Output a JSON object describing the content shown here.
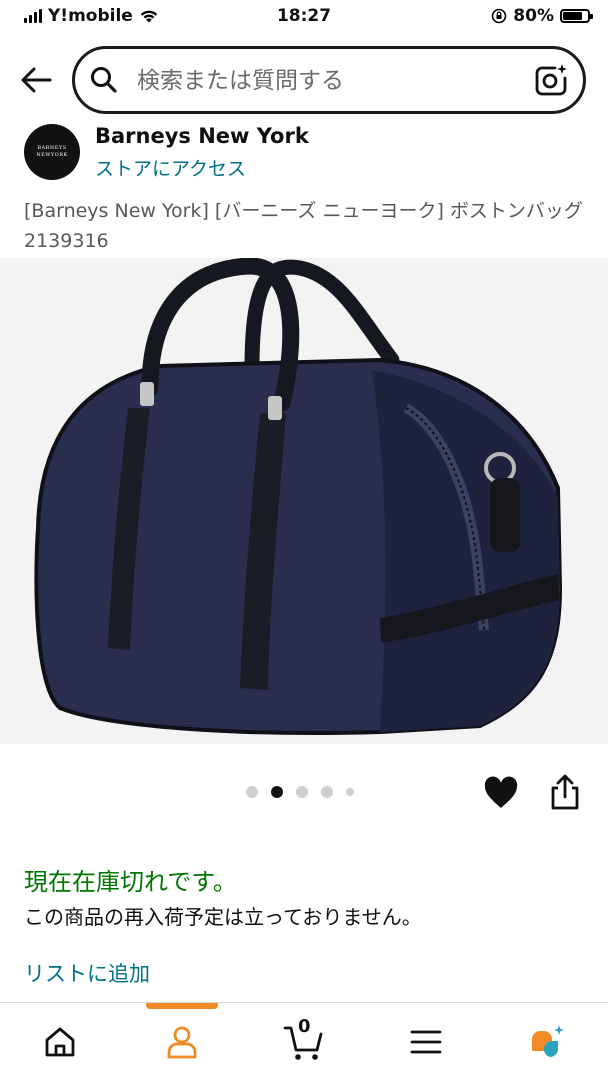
{
  "status_bar": {
    "carrier": "Y!mobile",
    "time": "18:27",
    "battery": "80%",
    "battery_level": 0.8
  },
  "search": {
    "placeholder": "検索または質問する"
  },
  "brand": {
    "name": "Barneys New York",
    "store_link": "ストアにアクセス",
    "logo_line1": "BARNEYS",
    "logo_line2": "NEWYORK"
  },
  "product": {
    "title": "[Barneys New York] [バーニーズ ニューヨーク] ボストンバッグ 2139316"
  },
  "carousel": {
    "total": 5,
    "active_index": 1
  },
  "availability": {
    "status": "現在在庫切れです。",
    "note": "この商品の再入荷予定は立っておりません。"
  },
  "actions": {
    "add_to_list": "リストに追加"
  },
  "bottom_nav": {
    "cart_count": "0",
    "active": "account"
  },
  "colors": {
    "accent_orange": "#f28a25",
    "link_teal": "#007185",
    "stock_green": "#007600",
    "bag_navy": "#2a2d4e"
  }
}
